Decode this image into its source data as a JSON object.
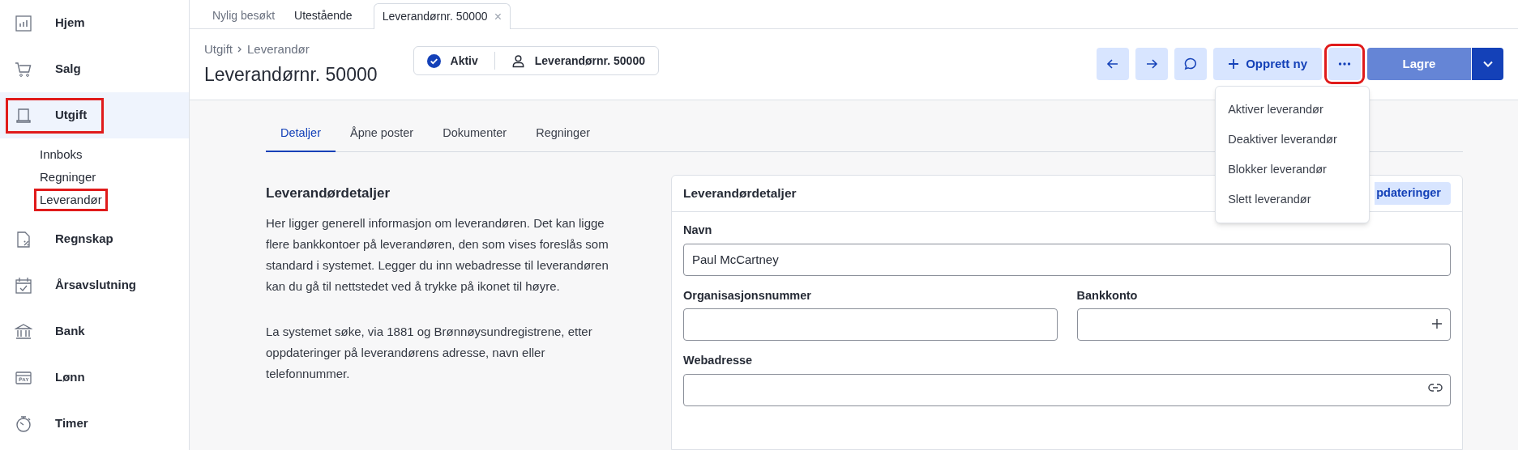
{
  "sidebar": {
    "items": [
      {
        "label": "Hjem",
        "selected": false,
        "highlighted": false
      },
      {
        "label": "Salg",
        "selected": false,
        "highlighted": false
      },
      {
        "label": "Utgift",
        "selected": true,
        "highlighted": true,
        "children": [
          {
            "label": "Innboks",
            "highlighted": false
          },
          {
            "label": "Regninger",
            "highlighted": false
          },
          {
            "label": "Leverandør",
            "highlighted": true
          }
        ]
      },
      {
        "label": "Regnskap",
        "selected": false,
        "highlighted": false
      },
      {
        "label": "Årsavslutning",
        "selected": false,
        "highlighted": false
      },
      {
        "label": "Bank",
        "selected": false,
        "highlighted": false
      },
      {
        "label": "Lønn",
        "selected": false,
        "highlighted": false
      },
      {
        "label": "Timer",
        "selected": false,
        "highlighted": false
      }
    ]
  },
  "top_tabs": [
    {
      "label": "Nylig besøkt",
      "selected": false
    },
    {
      "label": "Utestående",
      "selected": false
    },
    {
      "label": "Leverandørnr. 50000",
      "selected": true,
      "close": "×"
    }
  ],
  "breadcrumb": [
    "Utgift",
    "Leverandør"
  ],
  "title": "Leverandørnr. 50000",
  "status_pill": {
    "status": "Aktiv",
    "supplier": "Leverandørnr. 50000"
  },
  "toolbar": {
    "new_button": "Opprett ny",
    "more_highlighted": true,
    "save_button": "Lagre"
  },
  "more_menu": [
    "Aktiver leverandør",
    "Deaktiver leverandør",
    "Blokker leverandør",
    "Slett leverandør"
  ],
  "tabs": [
    {
      "label": "Detaljer",
      "selected": true
    },
    {
      "label": "Åpne poster",
      "selected": false
    },
    {
      "label": "Dokumenter",
      "selected": false
    },
    {
      "label": "Regninger",
      "selected": false
    }
  ],
  "section": {
    "heading": "Leverandørdetaljer",
    "paragraphs": [
      "Her ligger generell informasjon om leverandøren. Det kan ligge flere bankkontoer på leverandøren, den som vises foreslås som standard i systemet. Legger du inn webadresse til leverandøren kan du gå til nettstedet ved å trykke på ikonet til høyre.",
      "La systemet søke, via 1881 og Brønnøysundregistrene, etter oppdateringer på leverandørens adresse, navn eller telefonnummer."
    ]
  },
  "card": {
    "title": "Leverandørdetaljer",
    "updates_button": "pdateringer",
    "fields": [
      {
        "label": "Navn",
        "value": "Paul McCartney",
        "kind": "plain"
      },
      {
        "label": "Organisasjonsnummer",
        "kind": "plain"
      },
      {
        "label": "Bankkonto",
        "kind": "add"
      },
      {
        "label": "Webadresse",
        "kind": "link"
      }
    ]
  }
}
